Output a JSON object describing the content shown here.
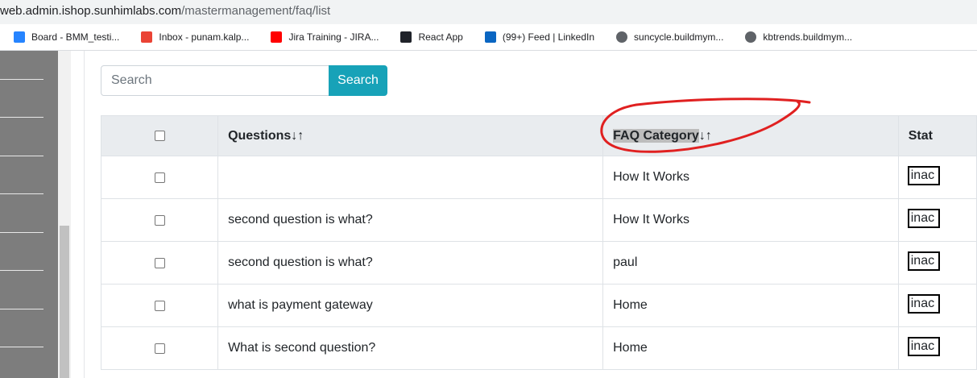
{
  "browser": {
    "url_host": "web.admin.ishop.sunhimlabs.com",
    "url_path": "/mastermanagement/faq/list",
    "bookmarks": [
      {
        "label": "Board - BMM_testi...",
        "icon": "jira-board-icon",
        "color": "#2684ff"
      },
      {
        "label": "Inbox - punam.kalp...",
        "icon": "gmail-icon",
        "color": "#ea4335"
      },
      {
        "label": "Jira Training - JIRA...",
        "icon": "youtube-icon",
        "color": "#ff0000"
      },
      {
        "label": "React App",
        "icon": "react-icon",
        "color": "#20232a"
      },
      {
        "label": "(99+) Feed | LinkedIn",
        "icon": "linkedin-icon",
        "color": "#0a66c2"
      },
      {
        "label": "suncycle.buildmym...",
        "icon": "globe-icon",
        "color": "#5f6368"
      },
      {
        "label": "kbtrends.buildmym...",
        "icon": "globe-icon",
        "color": "#5f6368"
      }
    ]
  },
  "search": {
    "placeholder": "Search",
    "button_label": "Search",
    "button_color": "#17a2b8"
  },
  "table": {
    "headers": [
      "Questions↓↑",
      "FAQ Category↓↑",
      "Stat"
    ],
    "header_faq_text": "FAQ Category",
    "header_faq_arrows": "↓↑",
    "rows": [
      {
        "question": "",
        "category": "How It Works",
        "status": "inac"
      },
      {
        "question": "second question is what?",
        "category": "How It Works",
        "status": "inac"
      },
      {
        "question": "second question is what?",
        "category": "paul",
        "status": "inac"
      },
      {
        "question": "what is payment gateway",
        "category": "Home",
        "status": "inac"
      },
      {
        "question": "What is second question?",
        "category": "Home",
        "status": "inac"
      }
    ]
  },
  "annotation_color": "#e02020"
}
